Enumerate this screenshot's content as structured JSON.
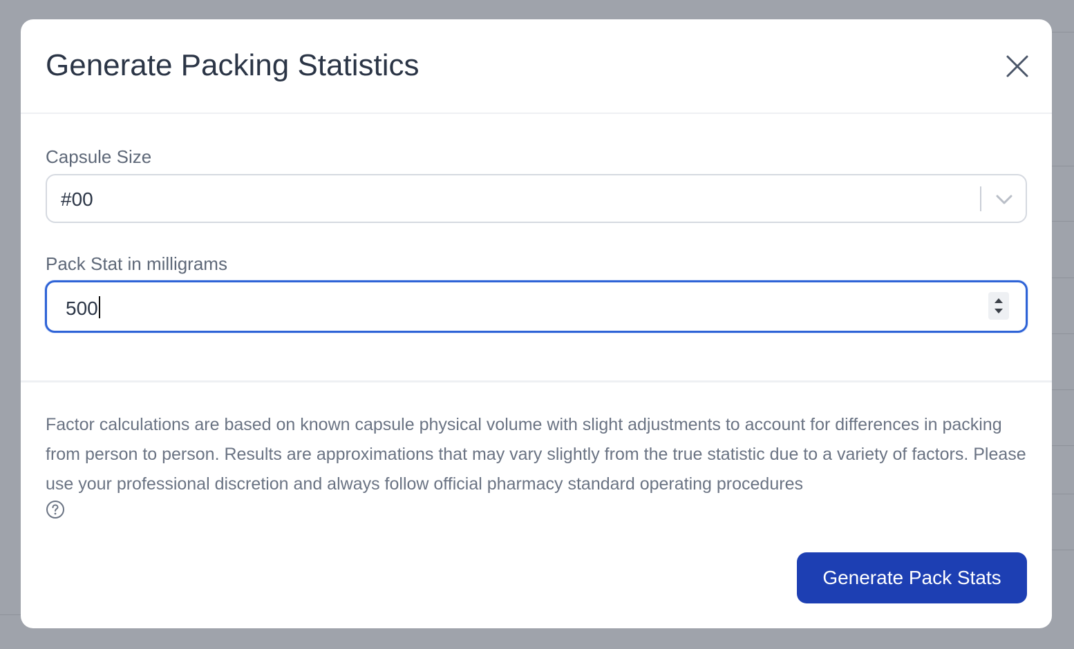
{
  "modal": {
    "title": "Generate Packing Statistics",
    "close_icon": "close-icon"
  },
  "capsule_size": {
    "label": "Capsule Size",
    "selected_value": "#00",
    "icon": "chevron-down-icon"
  },
  "pack_stat": {
    "label": "Pack Stat in milligrams",
    "value": "500"
  },
  "disclaimer": {
    "text": "Factor calculations are based on known capsule physical volume with slight adjustments to account for differences in packing from person to person. Results are approximations that may vary slightly from the true statistic due to a variety of factors. Please use your professional discretion and always follow official pharmacy standard operating procedures",
    "icon": "help-circle-icon"
  },
  "actions": {
    "primary_label": "Generate Pack Stats"
  },
  "colors": {
    "primary": "#1d3fb3",
    "focus_ring": "#2e63d6",
    "overlay": "#9fa3ab"
  }
}
